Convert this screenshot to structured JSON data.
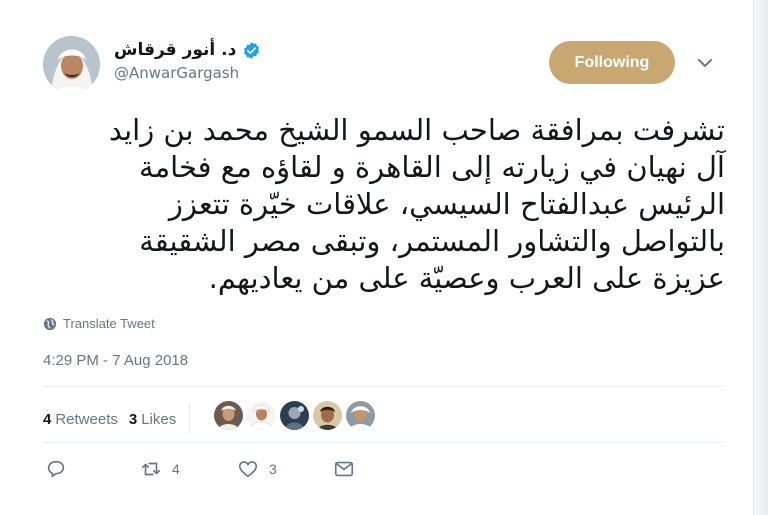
{
  "user": {
    "display_name": "د. أنور قرقاش",
    "handle": "@AnwarGargash",
    "verified": true,
    "avatar_icon": "avatar-photo-man-in-ghutra"
  },
  "follow_button": {
    "label": "Following",
    "color": "#c8a870"
  },
  "tweet": {
    "lines": [
      "تشرفت بمرافقة صاحب السمو الشيخ محمد بن زايد",
      "آل نهيان في زيارته إلى القاهرة و لقاؤه مع فخامة",
      "الرئيس عبدالفتاح السيسي، علاقات خيّرة تتعزز",
      "بالتواصل والتشاور المستمر، وتبقى مصر الشقيقة",
      "عزيزة على العرب وعصيّة على من يعاديهم."
    ]
  },
  "translate_label": "Translate Tweet",
  "timestamp": "4:29 PM - 7 Aug 2018",
  "stats": {
    "retweets_count": "4",
    "retweets_label": "Retweets",
    "likes_count": "3",
    "likes_label": "Likes"
  },
  "likers": [
    {
      "icon": "liker-avatar-1"
    },
    {
      "icon": "liker-avatar-2"
    },
    {
      "icon": "liker-avatar-3"
    },
    {
      "icon": "liker-avatar-4"
    },
    {
      "icon": "liker-avatar-5"
    }
  ],
  "actions": {
    "reply_count": "",
    "retweet_count": "4",
    "like_count": "3"
  }
}
